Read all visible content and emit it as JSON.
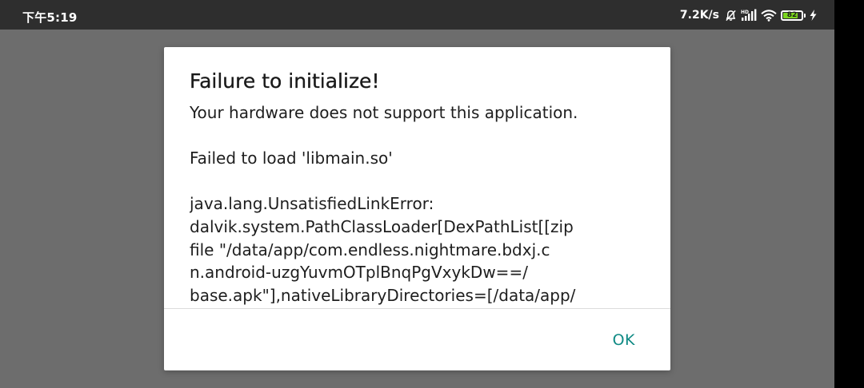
{
  "status_bar": {
    "time": "下午5:19",
    "net_speed": "7.2K/s",
    "icons": [
      "alarm-off-icon",
      "hd-signal-icon",
      "wifi-icon",
      "battery-icon",
      "charging-icon"
    ],
    "battery_level": "82",
    "battery_fraction": 0.82,
    "battery_color": "#7bd61e"
  },
  "dialog": {
    "title": "Failure to initialize!",
    "message": "Your hardware does not support this application.",
    "detail": "Failed to load 'libmain.so'",
    "error_lines": [
      "java.lang.UnsatisfiedLinkError:",
      "dalvik.system.PathClassLoader[DexPathList[[zip",
      "file \"/data/app/com.endless.nightmare.bdxj.c",
      "n.android-uzgYuvmOTplBnqPgVxykDw==/",
      "base.apk\"],nativeLibraryDirectories=[/data/app/"
    ],
    "ok_label": "OK",
    "accent_color": "#0f8a84"
  }
}
